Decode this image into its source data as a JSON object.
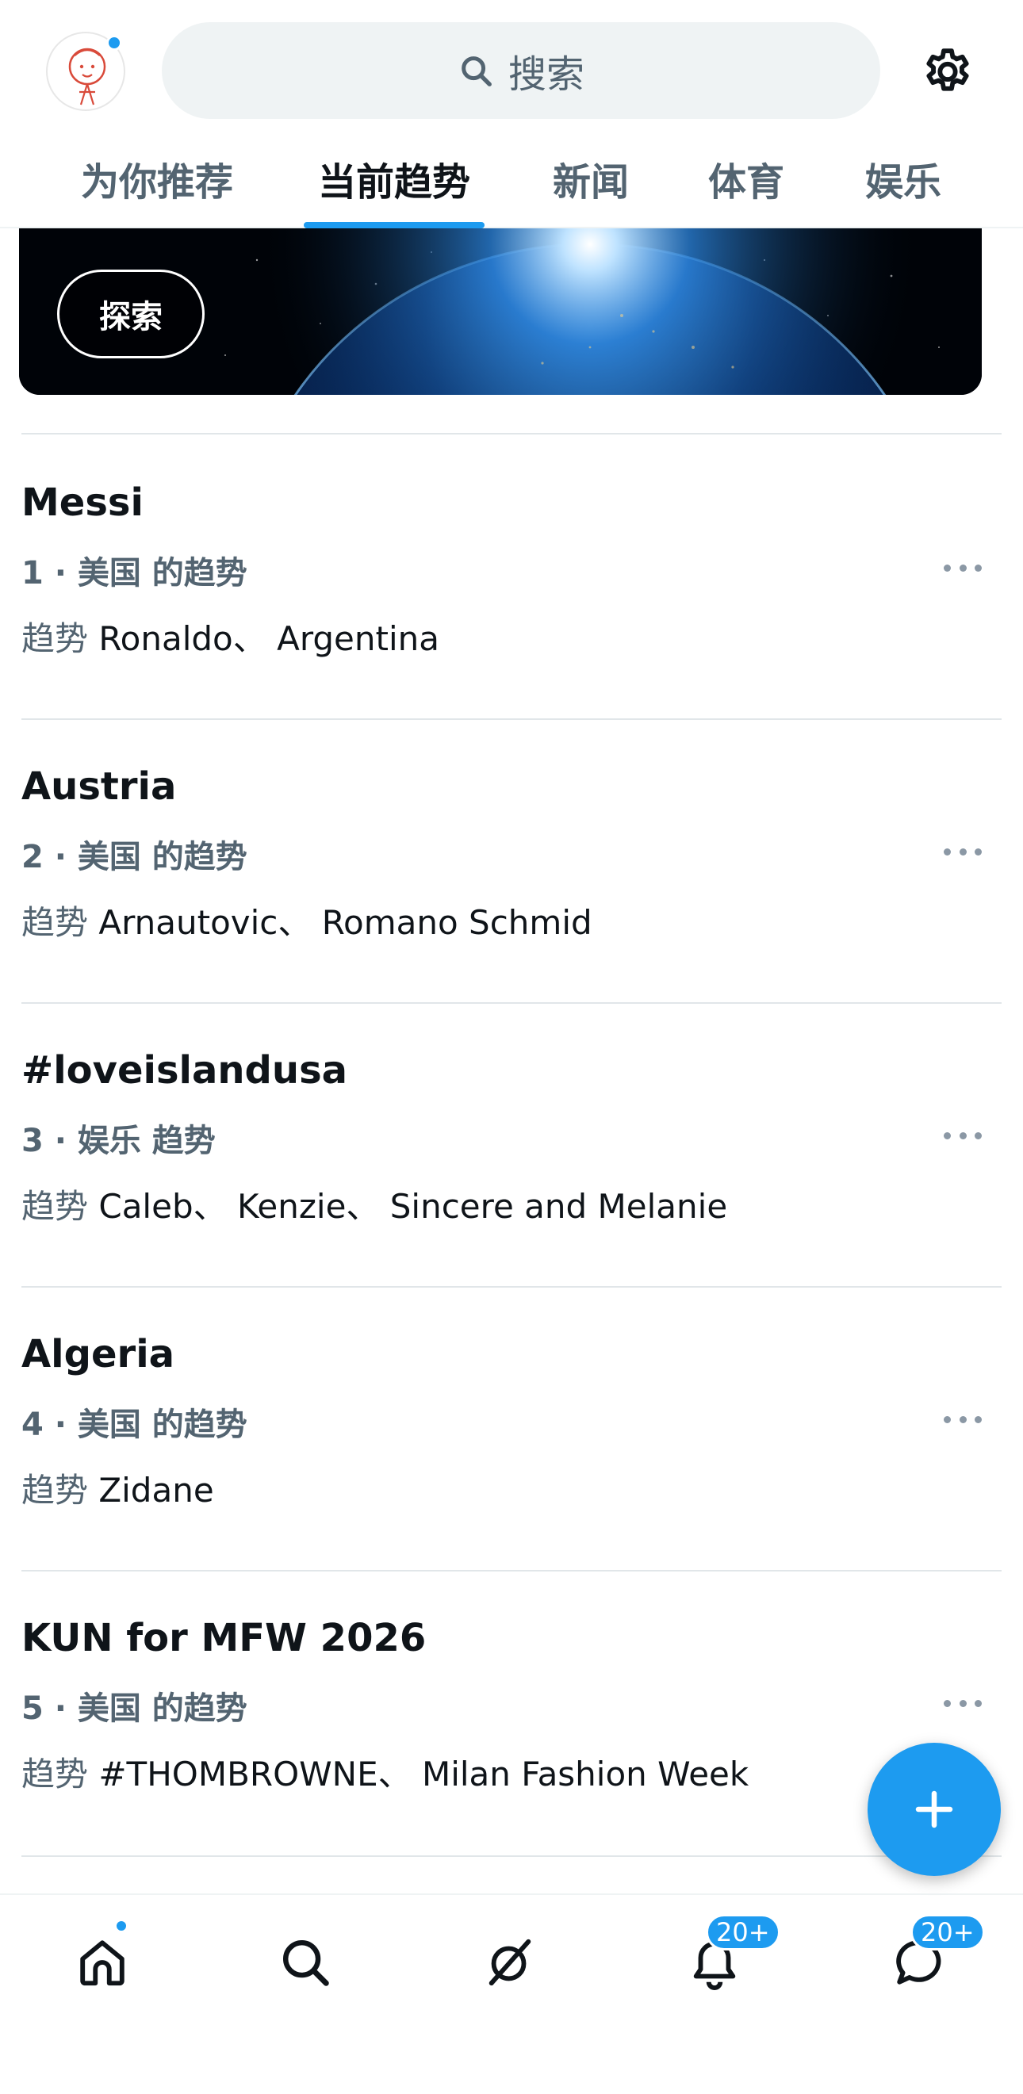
{
  "header": {
    "search_placeholder": "搜索",
    "tabs": [
      {
        "label": "为你推荐"
      },
      {
        "label": "当前趋势"
      },
      {
        "label": "新闻"
      },
      {
        "label": "体育"
      },
      {
        "label": "娱乐"
      }
    ],
    "active_tab": "当前趋势"
  },
  "banner": {
    "explore_label": "探索"
  },
  "trends": [
    {
      "title": "Messi",
      "meta": "1 · 美国 的趋势",
      "desc_prefix": "趋势",
      "desc": " Ronaldo、 Argentina"
    },
    {
      "title": "Austria",
      "meta": "2 · 美国 的趋势",
      "desc_prefix": "趋势",
      "desc": " Arnautovic、 Romano Schmid"
    },
    {
      "title": "#loveislandusa",
      "meta": "3 · 娱乐 趋势",
      "desc_prefix": "趋势",
      "desc": " Caleb、 Kenzie、 Sincere and Melanie"
    },
    {
      "title": "Algeria",
      "meta": "4 · 美国 的趋势",
      "desc_prefix": "趋势",
      "desc": " Zidane"
    },
    {
      "title": "KUN for MFW 2026",
      "meta": "5 · 美国 的趋势",
      "desc_prefix": "趋势",
      "desc": " #THOMBROWNE、 Milan Fashion Week"
    }
  ],
  "bottom_nav": {
    "items": [
      "home-icon",
      "search-icon",
      "grok-icon",
      "bell-icon",
      "messages-icon"
    ],
    "notifications_badge": "20+",
    "messages_badge": "20+"
  },
  "colors": {
    "accent": "#1d9bf0",
    "text_primary": "#0f1419",
    "text_secondary": "#536471"
  }
}
